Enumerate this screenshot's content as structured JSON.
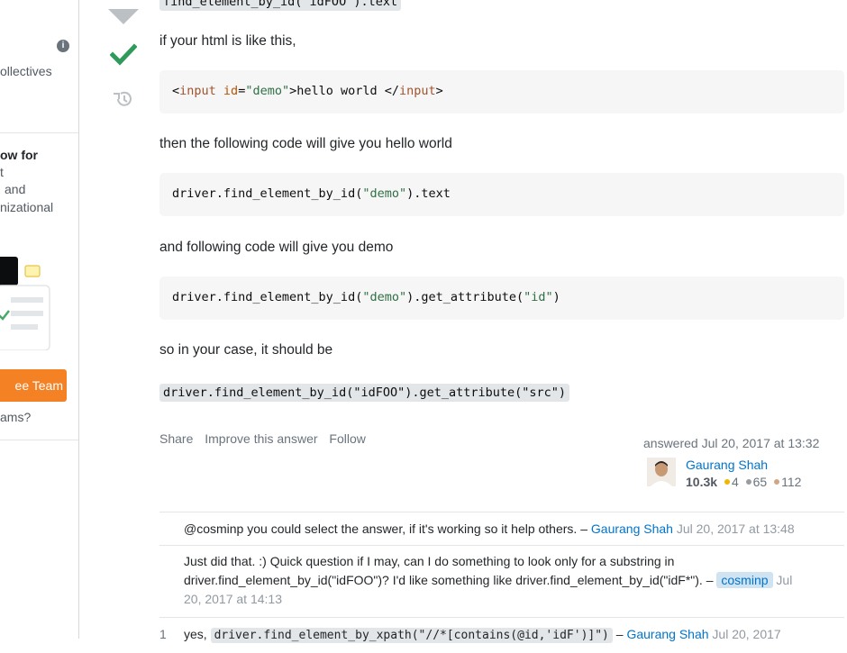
{
  "sidebar": {
    "info_icon": "info-icon",
    "collectives_text": "ollectives",
    "teams_heading": "ow for",
    "teams_line2": "t",
    "teams_line3": "and",
    "teams_line4": "nizational",
    "cta_button": "ee Team",
    "teams_question": "ams?"
  },
  "votes": {
    "downvote_icon": "downvote-arrow-icon",
    "accepted_icon": "accepted-check-icon",
    "history_icon": "history-icon",
    "accent_check": "#2f9a5c"
  },
  "answer": {
    "top_code": "find_element_by_id(\"idFOO\").text",
    "p1": "if your html is like this,",
    "code1_parts": [
      "<",
      "input",
      " ",
      "id",
      "=",
      "\"demo\"",
      ">hello world </",
      "input",
      ">"
    ],
    "p2": "then the following code will give you hello world",
    "code2_prefix": "driver.find_element_by_id(",
    "code2_str": "\"demo\"",
    "code2_suffix": ").text",
    "p3": "and following code will give you demo",
    "code3_prefix": "driver.find_element_by_id(",
    "code3_str1": "\"demo\"",
    "code3_mid": ").get_attribute(",
    "code3_str2": "\"id\"",
    "code3_suffix": ")",
    "p4": "so in your case, it should be",
    "code4": "driver.find_element_by_id(\"idFOO\").get_attribute(\"src\")"
  },
  "menu": {
    "share": "Share",
    "improve": "Improve this answer",
    "follow": "Follow"
  },
  "signature": {
    "answered": "answered Jul 20, 2017 at 13:32",
    "user_name": "Gaurang Shah",
    "reputation": "10.3k",
    "gold": "4",
    "silver": "65",
    "bronze": "112",
    "gold_color": "#f1b600",
    "silver_color": "#9a9ca0",
    "bronze_color": "#d1a684"
  },
  "comments": [
    {
      "text": "@cosminp you could select the answer, if it's working so it help others. –",
      "user": "Gaurang Shah",
      "date": "Jul 20, 2017 at 13:48"
    },
    {
      "line1": "Just did that. :) Quick question if I may, can I do something to look only for a substring in",
      "line2": "driver.find_element_by_id(\"idFOO\")? I'd like something like driver.find_element_by_id(\"idF*\"). –",
      "user": "cosminp",
      "date_part1": "Jul",
      "date_part2": "20, 2017 at 14:13"
    },
    {
      "score": "1",
      "text": "yes,",
      "code": "driver.find_element_by_xpath(\"//*[contains(@id,'idF')]\")",
      "user": "Gaurang Shah",
      "date": "Jul 20, 2017"
    }
  ]
}
